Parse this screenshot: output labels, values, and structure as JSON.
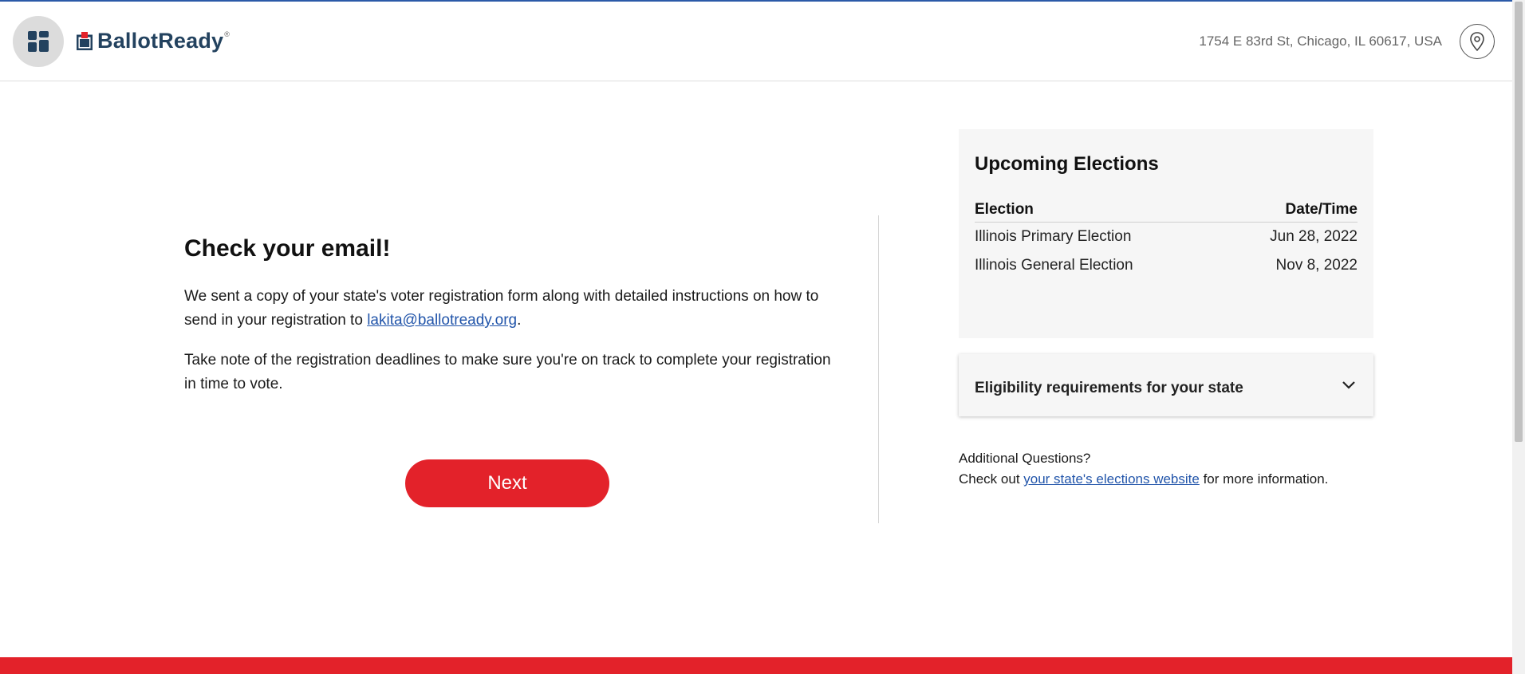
{
  "header": {
    "menu_icon": "dashboard-grid-icon",
    "logo_text": "BallotReady",
    "logo_reg": "®",
    "address": "1754 E 83rd St, Chicago, IL 60617, USA",
    "location_icon": "map-pin-icon"
  },
  "main": {
    "title": "Check your email!",
    "paragraph1_before": "We sent a copy of your state's voter registration form along with detailed instructions on how to send in your registration to ",
    "email": "lakita@ballotready.org",
    "paragraph1_after": ".",
    "paragraph2": "Take note of the registration deadlines to make sure you're on track to complete your registration in time to vote.",
    "next_label": "Next"
  },
  "sidebar": {
    "elections_title": "Upcoming Elections",
    "col_election": "Election",
    "col_datetime": "Date/Time",
    "elections": [
      {
        "name": "Illinois Primary Election",
        "date": "Jun 28, 2022"
      },
      {
        "name": "Illinois General Election",
        "date": "Nov 8, 2022"
      }
    ],
    "eligibility_title": "Eligibility requirements for your state",
    "additional_line1": "Additional Questions?",
    "additional_prefix": "Check out ",
    "additional_link": "your state's elections website",
    "additional_suffix": " for more information."
  },
  "colors": {
    "brand_navy": "#23425f",
    "accent_red": "#e3222a",
    "link_blue": "#2255aa",
    "card_bg": "#f6f6f6"
  }
}
